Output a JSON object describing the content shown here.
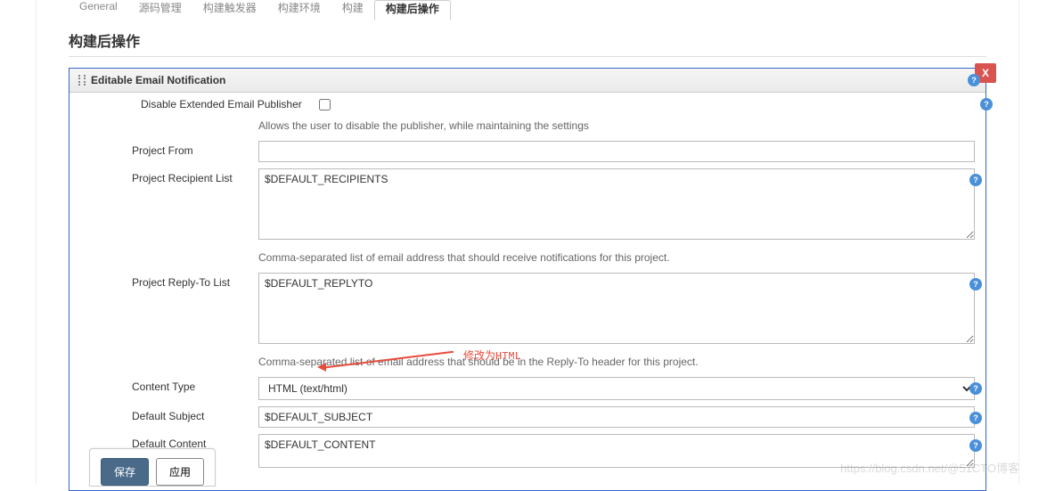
{
  "tabs": {
    "general": "General",
    "scm": "源码管理",
    "triggers": "构建触发器",
    "env": "构建环境",
    "build": "构建",
    "post": "构建后操作"
  },
  "section_title": "构建后操作",
  "step": {
    "title": "Editable Email Notification",
    "close": "X"
  },
  "fields": {
    "disable_label": "Disable Extended Email Publisher",
    "disable_help": "Allows the user to disable the publisher, while maintaining the settings",
    "project_from_label": "Project From",
    "project_from_value": "",
    "recipients_label": "Project Recipient List",
    "recipients_value": "$DEFAULT_RECIPIENTS",
    "recipients_help": "Comma-separated list of email address that should receive notifications for this project.",
    "replyto_label": "Project Reply-To List",
    "replyto_value": "$DEFAULT_REPLYTO",
    "replyto_help": "Comma-separated list of email address that should be in the Reply-To header for this project.",
    "content_type_label": "Content Type",
    "content_type_value": "HTML (text/html)",
    "subject_label": "Default Subject",
    "subject_value": "$DEFAULT_SUBJECT",
    "content_label": "Default Content",
    "content_value": "$DEFAULT_CONTENT"
  },
  "annotation": {
    "text": "修改为HTML"
  },
  "watermark": "https://blog.csdn.net/@51CTO博客",
  "buttons": {
    "save": "保存",
    "apply": "应用"
  }
}
